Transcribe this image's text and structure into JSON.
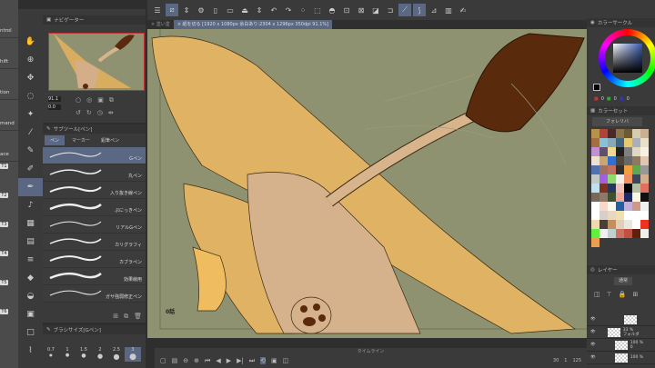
{
  "left_edge": {
    "items": [
      "ntrol",
      "hift",
      "tion",
      "mand",
      "ace"
    ],
    "tbuttons": [
      "T1",
      "T2",
      "T3",
      "T4",
      "T5",
      "T6"
    ]
  },
  "tools": {
    "icons": [
      "hand-icon",
      "zoom-icon",
      "move-icon",
      "lasso-icon",
      "magic-wand-icon",
      "eyedropper-icon",
      "pen-icon",
      "pencil-icon",
      "brush-icon",
      "airbrush-icon",
      "decoration-icon",
      "frame-icon",
      "ruler-icon",
      "eraser-icon",
      "fill-icon",
      "gradient-icon",
      "figure-icon",
      "correct-line-icon"
    ]
  },
  "navigator": {
    "title": "ナビゲーター",
    "zoom": "91.1",
    "angle": "0.0"
  },
  "subtool": {
    "title": "サブツール[ペン]",
    "tabs": [
      "ペン",
      "マーカー",
      "鉛筆ペン"
    ],
    "brushes": [
      "Gペン",
      "丸ペン",
      "入り抜き線ペン",
      "ぷにっきペン",
      "リアルGペン",
      "カリグラフィ",
      "カブラペン",
      "効果線用",
      "ガサ強弱修正ペン"
    ],
    "selected": 0
  },
  "brush_size": {
    "title": "ブラシサイズ[Gペン]",
    "sizes": [
      "0.7",
      "1",
      "1.5",
      "2",
      "2.5",
      "3"
    ],
    "selected": 5
  },
  "tabs": [
    {
      "label": "× 塗い塗"
    },
    {
      "label": "× 紙を切る [1920 x 1080px 余白あり:2304 x 1296px 350dpi 91.1%]",
      "active": true
    }
  ],
  "canvas": {
    "label": "0話",
    "bg": "#8f9270"
  },
  "timeline": {
    "title": "タイムライン",
    "frame_rate": "30",
    "current": "1",
    "end": "125"
  },
  "right": {
    "color_circle_title": "カラーサークル",
    "rgb": [
      "0",
      "0",
      "0"
    ],
    "color_set_title": "カラーセット",
    "color_set_name": "フォレリバ",
    "layer_title": "レイヤー",
    "blend": "通常",
    "layers": [
      {
        "opacity": "",
        "name": ""
      },
      {
        "opacity": "33 %",
        "name": "フォルダ"
      },
      {
        "opacity": "100 %",
        "name": "0"
      },
      {
        "opacity": "100 %",
        "name": ""
      }
    ],
    "swatches": [
      "#b8914a",
      "#b04438",
      "#4a2a28",
      "#8a7448",
      "#6b5a34",
      "#d8ccb0",
      "#c8b090",
      "#a07040",
      "#88c0d8",
      "#88a8b8",
      "#406880",
      "#e8c870",
      "#a8b0b8",
      "#e8e0c8",
      "#c090d0",
      "#605070",
      "#f0d890",
      "#202020",
      "#808080",
      "#e0d8c0",
      "#f8f0e0",
      "#f0e0d0",
      "#c8a870",
      "#3070d0",
      "#504838",
      "#686868",
      "#907860",
      "#e0c8b0",
      "#5070b0",
      "#a07060",
      "#c07060",
      "#303030",
      "#f0a040",
      "#60a850",
      "#989898",
      "#c0c8c8",
      "#a060e0",
      "#90d870",
      "#f0f0f0",
      "#f09060",
      "#384860",
      "#d0b090",
      "#c0e0f0",
      "#803020",
      "#283858",
      "#f0c0b8",
      "#000000",
      "#b0c0a0",
      "#e07060",
      "#786858",
      "#907868",
      "#405030",
      "#f0a898",
      "#202860",
      "#f8f8e0",
      "#101010",
      "#ffffff",
      "#f8d8c8",
      "#f8f8f0",
      "#2060a0",
      "#c0b0d8",
      "#d09888",
      "#f0f0f0",
      "#ffffff",
      "#d8d0c8",
      "#e8d8c0",
      "#f0e0b0",
      "#ffffff",
      "#ffffff",
      "#ffffff",
      "#f0d8b0",
      "#484038",
      "#c09060",
      "#e0d0b8",
      "#e8e8e0",
      "#ffffff",
      "#f03020",
      "#60f040",
      "#f0f0f0",
      "#c0d0d0",
      "#d07060",
      "#c05040",
      "#602010",
      "#f0f0e8",
      "#e8a050"
    ]
  }
}
